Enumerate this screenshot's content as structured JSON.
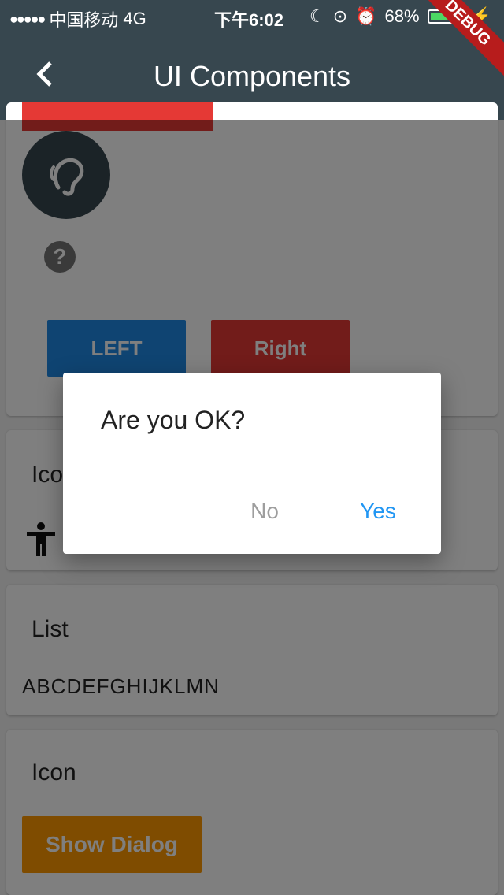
{
  "status_bar": {
    "carrier": "中国移动",
    "network": "4G",
    "time": "下午6:02",
    "battery": "68%"
  },
  "appbar": {
    "title": "UI Components",
    "debug_banner": "DEBUG"
  },
  "card1": {
    "help_glyph": "?",
    "left_button": "LEFT",
    "right_button": "Right"
  },
  "card2": {
    "heading": "Icon"
  },
  "card3": {
    "heading": "List",
    "text": "ABCDEFGHIJKLMN"
  },
  "card4": {
    "heading": "Icon",
    "button": "Show Dialog"
  },
  "dialog": {
    "title": "Are you OK?",
    "no": "No",
    "yes": "Yes"
  },
  "colors": {
    "appbar": "#37474f",
    "left_button": "#1e88e5",
    "right_button": "#e53935",
    "show_dialog": "#ff9800",
    "yes_button": "#2196f3"
  }
}
